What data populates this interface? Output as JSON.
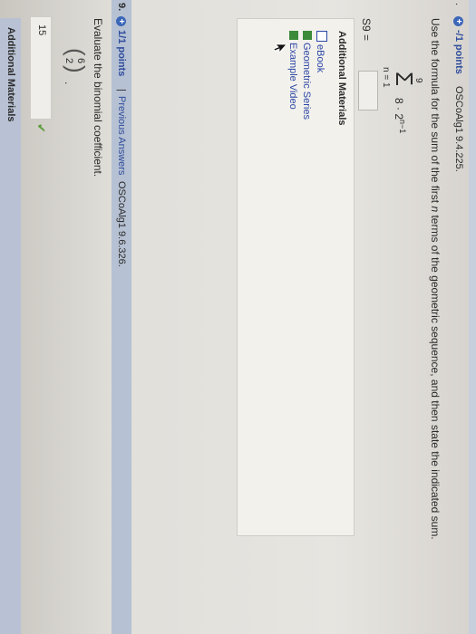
{
  "q8": {
    "number": ".",
    "points": "-/1 points",
    "ref": "OSCoAlg1 9.4.225.",
    "instruction": "Use the formula for the sum of the first",
    "instruction_var": "n",
    "instruction_rest": "terms of the geometric sequence, and then state the indicated sum.",
    "sigma_upper": "9",
    "sigma_symbol": "Σ",
    "sigma_lower": "n = 1",
    "term_base": "8 · 2",
    "term_exp": "n−1",
    "answer_label": "S9 =",
    "answer_value": ""
  },
  "materials": {
    "heading": "Additional Materials",
    "items": [
      "eBook",
      "Geometric Series",
      "Example Video"
    ]
  },
  "q9": {
    "number": "9.",
    "points": "1/1 points",
    "separator": "|",
    "prev_answers": "Previous Answers",
    "ref": "OSCoAlg1 9.6.326.",
    "instruction": "Evaluate the binomial coefficient.",
    "binom_top": "6",
    "binom_bottom": "2",
    "answer_value": "15",
    "check": "✔",
    "materials_heading": "Additional Materials"
  },
  "colors": {
    "link": "#2d47a6",
    "header_strip": "#b6c1d3",
    "check": "#5a9c3a"
  }
}
